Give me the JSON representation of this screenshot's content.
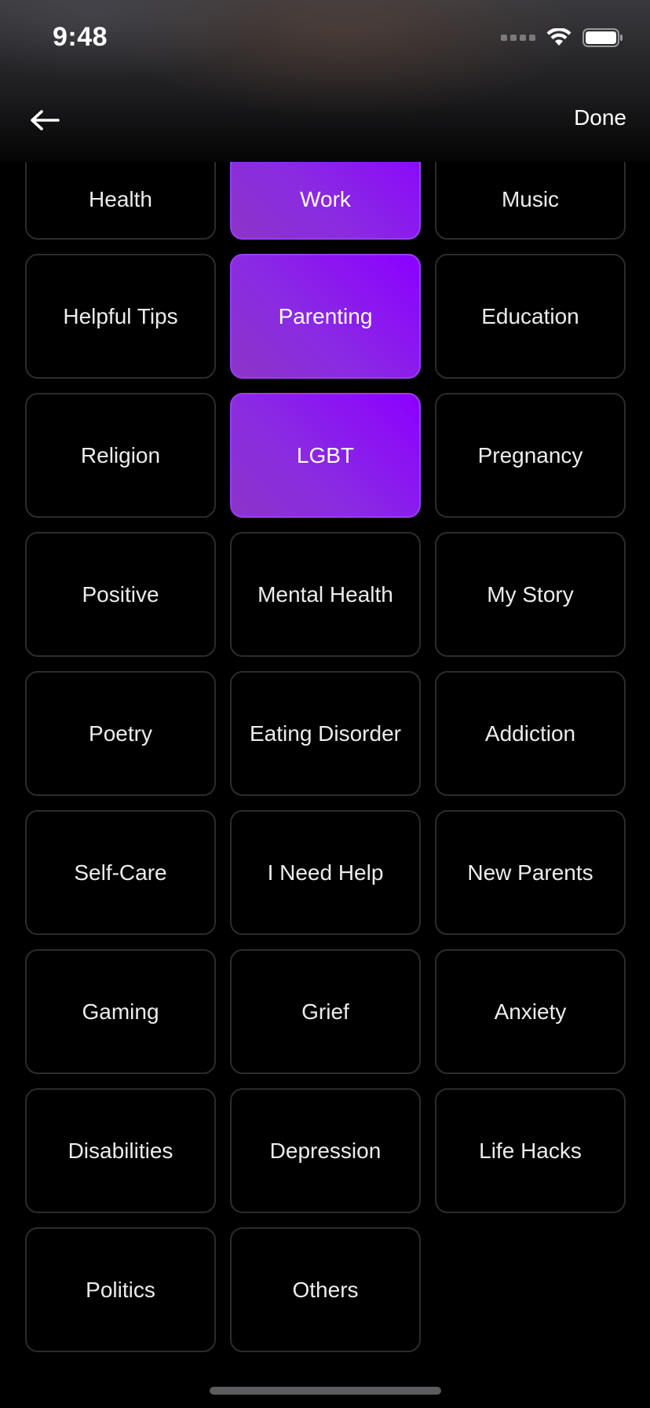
{
  "status_bar": {
    "time": "9:48"
  },
  "nav": {
    "back_icon": "arrow-left-icon",
    "done_label": "Done"
  },
  "colors": {
    "background": "#000000",
    "selected_tile_gradient_start": "#8c00ff",
    "selected_tile_gradient_end": "#8b35c8",
    "tile_border": "#2c2c2e"
  },
  "categories": [
    {
      "label": "Health",
      "selected": false
    },
    {
      "label": "Work",
      "selected": true
    },
    {
      "label": "Music",
      "selected": false
    },
    {
      "label": "Helpful Tips",
      "selected": false
    },
    {
      "label": "Parenting",
      "selected": true
    },
    {
      "label": "Education",
      "selected": false
    },
    {
      "label": "Religion",
      "selected": false
    },
    {
      "label": "LGBT",
      "selected": true
    },
    {
      "label": "Pregnancy",
      "selected": false
    },
    {
      "label": "Positive",
      "selected": false
    },
    {
      "label": "Mental Health",
      "selected": false
    },
    {
      "label": "My Story",
      "selected": false
    },
    {
      "label": "Poetry",
      "selected": false
    },
    {
      "label": "Eating Disorder",
      "selected": false
    },
    {
      "label": "Addiction",
      "selected": false
    },
    {
      "label": "Self-Care",
      "selected": false
    },
    {
      "label": "I Need Help",
      "selected": false
    },
    {
      "label": "New Parents",
      "selected": false
    },
    {
      "label": "Gaming",
      "selected": false
    },
    {
      "label": "Grief",
      "selected": false
    },
    {
      "label": "Anxiety",
      "selected": false
    },
    {
      "label": "Disabilities",
      "selected": false
    },
    {
      "label": "Depression",
      "selected": false
    },
    {
      "label": "Life Hacks",
      "selected": false
    },
    {
      "label": "Politics",
      "selected": false
    },
    {
      "label": "Others",
      "selected": false
    }
  ]
}
